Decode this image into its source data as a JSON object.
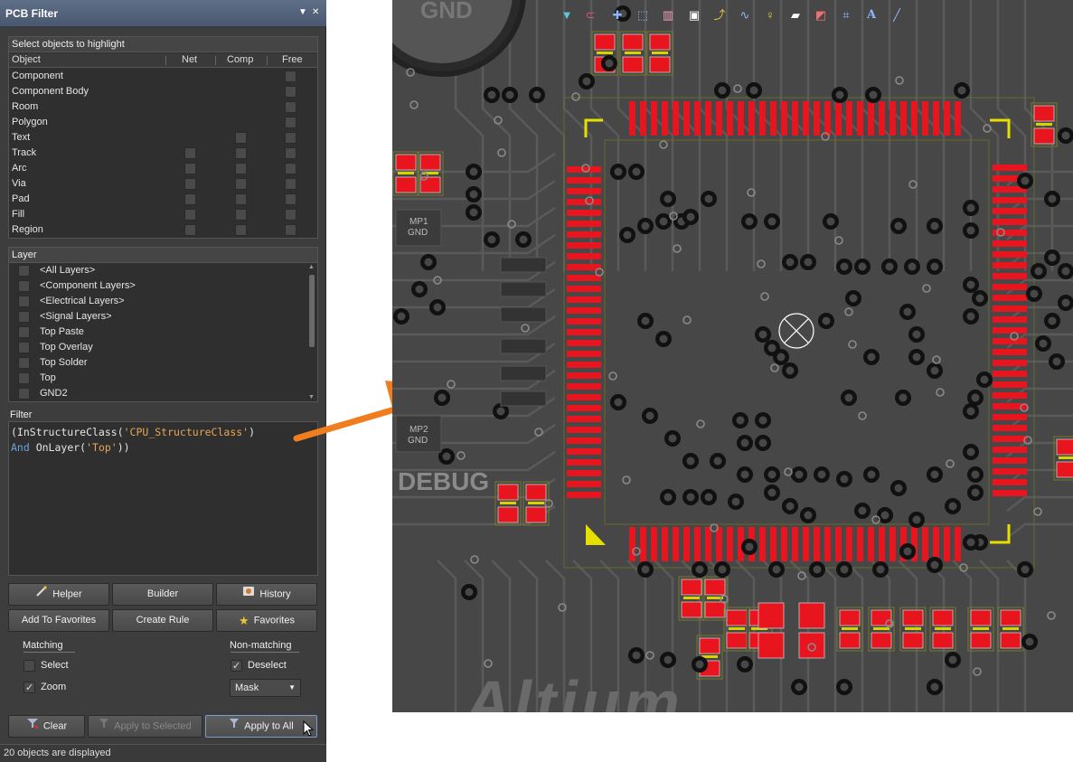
{
  "panel": {
    "title": "PCB Filter",
    "pin_icon": "▼",
    "close_icon": "✕",
    "objects": {
      "header": "Select objects to highlight",
      "columns": [
        "Object",
        "Net",
        "Comp",
        "Free"
      ],
      "rows": [
        {
          "label": "Component",
          "net": null,
          "comp": null,
          "free": false
        },
        {
          "label": "Component Body",
          "net": null,
          "comp": null,
          "free": false
        },
        {
          "label": "Room",
          "net": null,
          "comp": null,
          "free": false
        },
        {
          "label": "Polygon",
          "net": null,
          "comp": null,
          "free": false
        },
        {
          "label": "Text",
          "net": null,
          "comp": false,
          "free": false
        },
        {
          "label": "Track",
          "net": false,
          "comp": false,
          "free": false
        },
        {
          "label": "Arc",
          "net": false,
          "comp": false,
          "free": false
        },
        {
          "label": "Via",
          "net": false,
          "comp": false,
          "free": false
        },
        {
          "label": "Pad",
          "net": false,
          "comp": false,
          "free": false
        },
        {
          "label": "Fill",
          "net": false,
          "comp": false,
          "free": false
        },
        {
          "label": "Region",
          "net": false,
          "comp": false,
          "free": false
        }
      ]
    },
    "layers": {
      "header": "Layer",
      "items": [
        "<All Layers>",
        "<Component Layers>",
        "<Electrical Layers>",
        "<Signal Layers>",
        "Top Paste",
        "Top Overlay",
        "Top Solder",
        "Top",
        "GND2"
      ]
    },
    "filter": {
      "label": "Filter",
      "line1_a": "(InStructureClass(",
      "line1_b": "'CPU_StructureClass'",
      "line1_c": ")",
      "line2_kw": "And",
      "line2_a": " OnLayer(",
      "line2_b": "'Top'",
      "line2_c": "))"
    },
    "buttons": {
      "helper": "Helper",
      "builder": "Builder",
      "history": "History",
      "add_favorites": "Add To Favorites",
      "create_rule": "Create Rule",
      "favorites": "Favorites",
      "clear": "Clear",
      "apply_selected": "Apply to Selected",
      "apply_all": "Apply to All"
    },
    "matching": {
      "label": "Matching",
      "select": {
        "label": "Select",
        "checked": false
      },
      "zoom": {
        "label": "Zoom",
        "checked": true
      }
    },
    "nonmatching": {
      "label": "Non-matching",
      "deselect": {
        "label": "Deselect",
        "checked": true
      },
      "mode": "Mask"
    },
    "status": "20 objects are displayed"
  },
  "pcb": {
    "labels": {
      "gnd_top": "GND",
      "mp1": "MP1",
      "mp1_net": "GND",
      "mp2": "MP2",
      "mp2_net": "GND",
      "debug": "DEBUG",
      "brand": "Altium"
    },
    "colors": {
      "board": "#474747",
      "pad": "#e8141e",
      "pad_border": "#c8c8c8",
      "silk": "#d7d200",
      "highlight_arrow": "#f07d1e"
    }
  }
}
